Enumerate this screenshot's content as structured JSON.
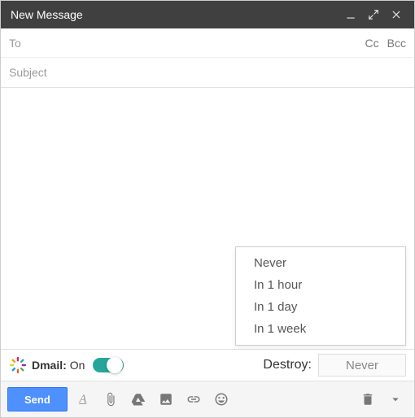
{
  "titlebar": {
    "title": "New Message"
  },
  "fields": {
    "to_placeholder": "To",
    "cc_label": "Cc",
    "bcc_label": "Bcc",
    "subject_placeholder": "Subject"
  },
  "destroy_options": {
    "opt0": "Never",
    "opt1": "In 1 hour",
    "opt2": "In 1 day",
    "opt3": "In 1 week"
  },
  "dmail": {
    "label": "Dmail:",
    "state": "On",
    "destroy_label": "Destroy:",
    "destroy_selected": "Never"
  },
  "toolbar": {
    "send_label": "Send"
  }
}
